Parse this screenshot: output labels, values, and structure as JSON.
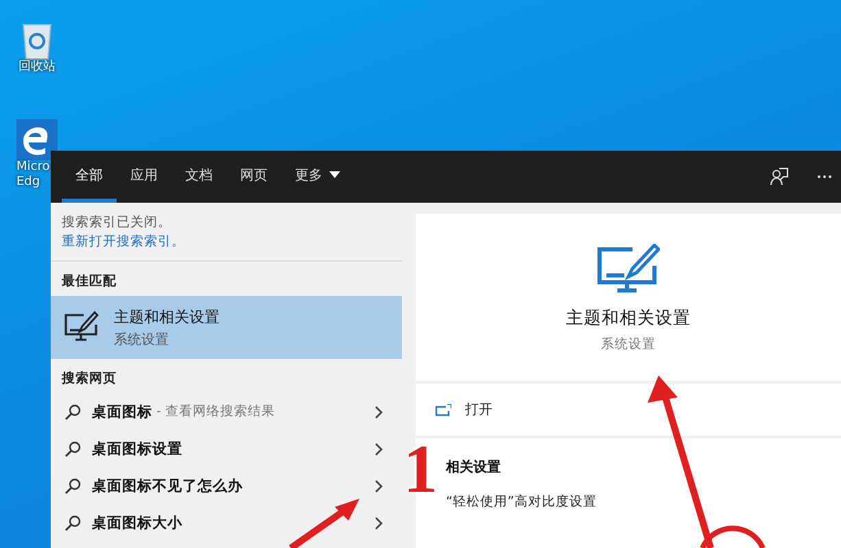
{
  "desktop": {
    "icons": [
      {
        "kind": "recycle-bin",
        "lines": [
          "回收站"
        ]
      },
      {
        "kind": "browser",
        "lines": [
          "Micro",
          "Edg"
        ]
      }
    ]
  },
  "search_window": {
    "tabs": [
      {
        "label": "全部",
        "selected": true,
        "kind": "tab"
      },
      {
        "label": "应用",
        "selected": false,
        "kind": "tab"
      },
      {
        "label": "文档",
        "selected": false,
        "kind": "tab"
      },
      {
        "label": "网页",
        "selected": false,
        "kind": "tab"
      },
      {
        "label": "更多",
        "selected": false,
        "kind": "dropdown"
      }
    ],
    "notice": {
      "text": "搜索索引已关闭。",
      "link": "重新打开搜索索引。"
    },
    "best_match": {
      "heading": "最佳匹配",
      "title": "主题和相关设置",
      "subtitle": "系统设置",
      "selected": true
    },
    "web_search": {
      "heading": "搜索网页",
      "results": [
        {
          "text": "桌面图标",
          "suffix": "- 查看网络搜索结果"
        },
        {
          "text": "桌面图标设置"
        },
        {
          "text": "桌面图标不见了怎么办"
        },
        {
          "text": "桌面图标大小"
        }
      ]
    },
    "preview": {
      "title": "主题和相关设置",
      "subtitle": "系统设置",
      "actions": [
        {
          "label": "打开"
        }
      ],
      "related_heading": "相关设置",
      "related_links": [
        "“轻松使用”高对比度设置"
      ]
    }
  },
  "annotation": {
    "step_label": "1"
  }
}
